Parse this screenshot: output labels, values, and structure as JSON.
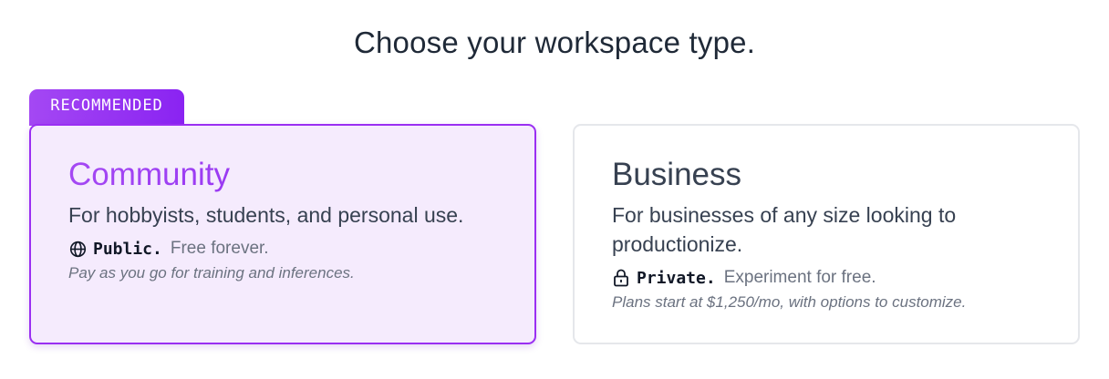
{
  "heading": "Choose your workspace type.",
  "options": [
    {
      "badge": "RECOMMENDED",
      "title": "Community",
      "description": "For hobbyists, students, and personal use.",
      "access_icon": "globe-icon",
      "access_mode": "Public.",
      "access_note": "Free forever.",
      "pricing_note": "Pay as you go for training and inferences.",
      "selected": true
    },
    {
      "title": "Business",
      "description": "For businesses of any size looking to productionize.",
      "access_icon": "lock-icon",
      "access_mode": "Private.",
      "access_note": "Experiment for free.",
      "pricing_note": "Plans start at $1,250/mo, with options to customize.",
      "selected": false
    }
  ],
  "colors": {
    "accent_start": "#a448f3",
    "accent_end": "#8a23f2",
    "selected_background": "#f5ebfd",
    "card_border": "#e5e7eb"
  }
}
